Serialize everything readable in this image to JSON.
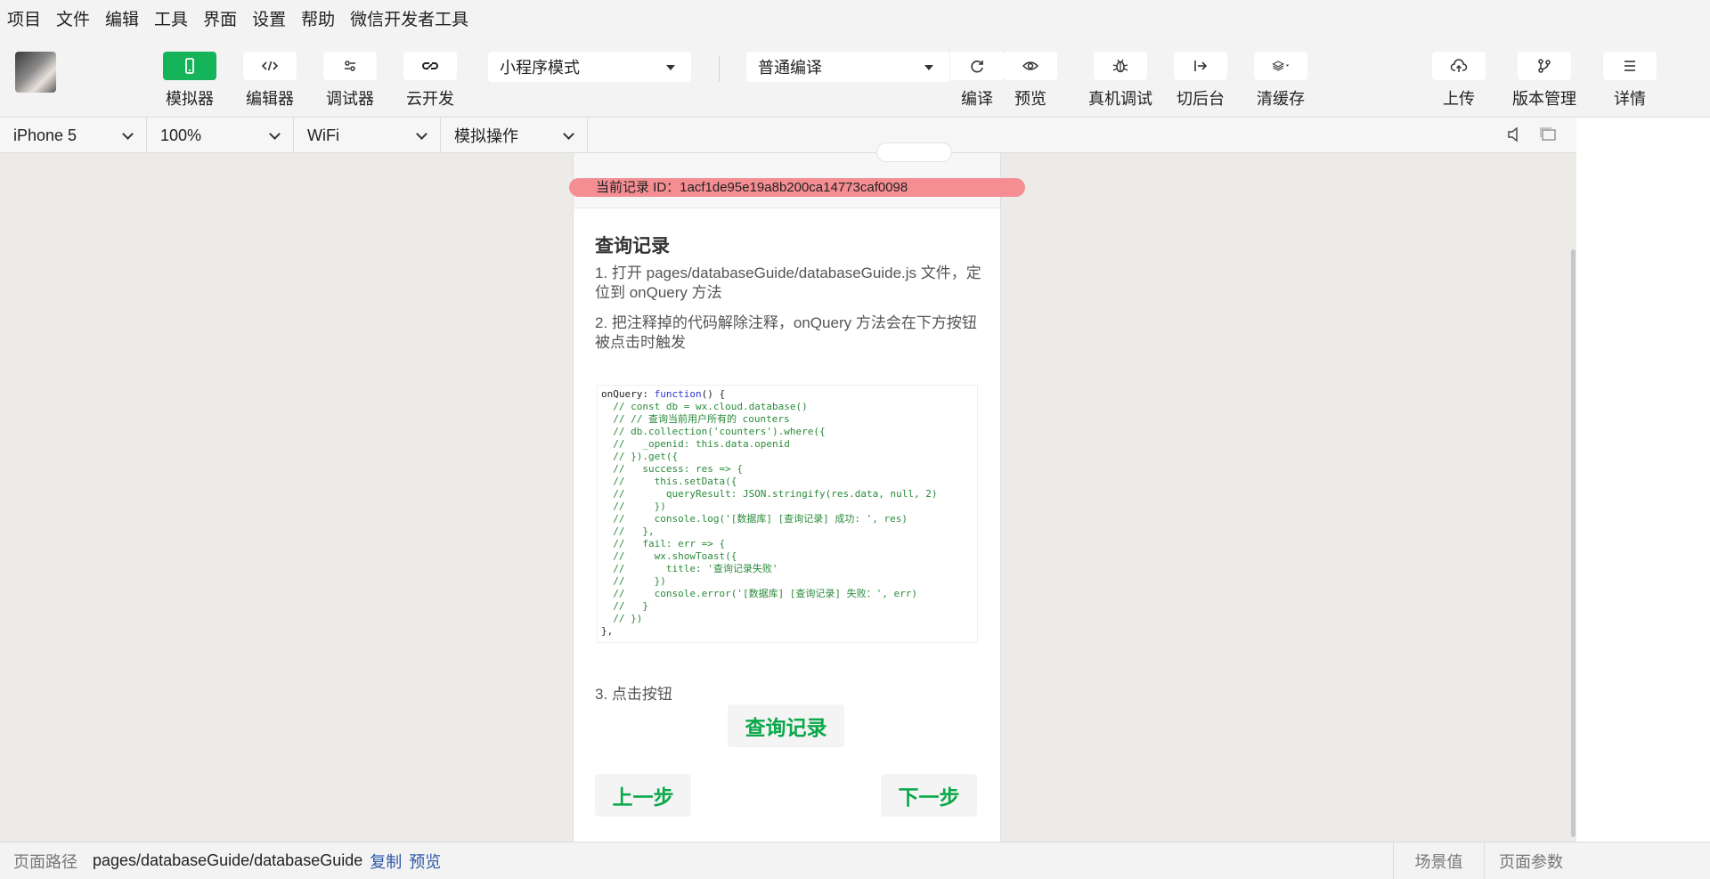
{
  "menu": [
    "项目",
    "文件",
    "编辑",
    "工具",
    "界面",
    "设置",
    "帮助",
    "微信开发者工具"
  ],
  "toolbar": {
    "simulator_label": "模拟器",
    "editor_label": "编辑器",
    "debugger_label": "调试器",
    "cloud_label": "云开发",
    "mode_select": "小程序模式",
    "compile_select": "普通编译",
    "compile_label": "编译",
    "preview_label": "预览",
    "realdebug_label": "真机调试",
    "background_label": "切后台",
    "clearcache_label": "清缓存",
    "upload_label": "上传",
    "version_label": "版本管理",
    "details_label": "详情"
  },
  "devicebar": {
    "device": "iPhone 5",
    "zoom": "100%",
    "network": "WiFi",
    "simulate": "模拟操作"
  },
  "page": {
    "record_id": "当前记录 ID：1acf1de95e19a8b200ca14773caf0098",
    "title": "查询记录",
    "step1": "1. 打开 pages/databaseGuide/databaseGuide.js 文件，定位到 onQuery 方法",
    "step2": "2. 把注释掉的代码解除注释，onQuery 方法会在下方按钮被点击时触发",
    "step3": "3. 点击按钮",
    "query_button": "查询记录",
    "prev_button": "上一步",
    "next_button": "下一步",
    "code": {
      "line1_key": "onQuery: ",
      "line1_fn": "function",
      "line1_rest": "() {",
      "body": [
        "  // const db = wx.cloud.database()",
        "  // // 查询当前用户所有的 counters",
        "  // db.collection('counters').where({",
        "  //   _openid: this.data.openid",
        "  // }).get({",
        "  //   success: res => {",
        "  //     this.setData({",
        "  //       queryResult: JSON.stringify(res.data, null, 2)",
        "  //     })",
        "  //     console.log('[数据库] [查询记录] 成功: ', res)",
        "  //   },",
        "  //   fail: err => {",
        "  //     wx.showToast({",
        "  //       title: '查询记录失败'",
        "  //     })",
        "  //     console.error('[数据库] [查询记录] 失败：', err)",
        "  //   }",
        "  // })"
      ],
      "last": "},"
    }
  },
  "statusbar": {
    "path_label": "页面路径",
    "path": "pages/databaseGuide/databaseGuide",
    "copy": "复制",
    "preview": "预览",
    "scene": "场景值",
    "params": "页面参数"
  },
  "colors": {
    "accent_green": "#15b35a",
    "button_green_text": "#0aa84a",
    "record_bar": "#f48e92",
    "link_blue": "#2f5aa8"
  }
}
